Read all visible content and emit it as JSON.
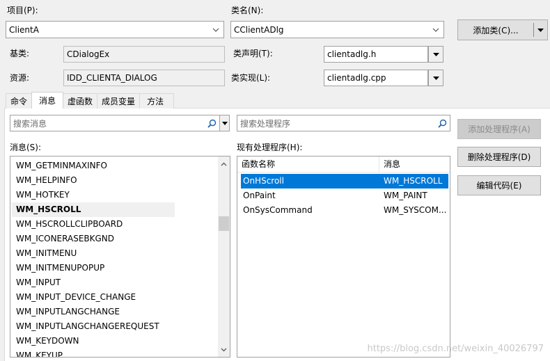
{
  "labels": {
    "project": "项目(P):",
    "classname": "类名(N):",
    "base_class": "基类:",
    "class_decl": "类声明(T):",
    "resource": "资源:",
    "class_impl": "类实现(L):"
  },
  "project_value": "ClientA",
  "classname_value": "CClientADlg",
  "add_class_button": "添加类(C)...",
  "base_class_value": "CDialogEx",
  "class_decl_value": "clientadlg.h",
  "resource_value": "IDD_CLIENTA_DIALOG",
  "class_impl_value": "clientadlg.cpp",
  "tabs": [
    "命令",
    "消息",
    "虚函数",
    "成员变量",
    "方法"
  ],
  "active_tab": "消息",
  "search_messages_placeholder": "搜索消息",
  "search_handlers_placeholder": "搜索处理程序",
  "messages_label": "消息(S):",
  "handlers_label": "现有处理程序(H):",
  "messages": [
    "WM_GETMINMAXINFO",
    "WM_HELPINFO",
    "WM_HOTKEY",
    "WM_HSCROLL",
    "WM_HSCROLLCLIPBOARD",
    "WM_ICONERASEBKGND",
    "WM_INITMENU",
    "WM_INITMENUPOPUP",
    "WM_INPUT",
    "WM_INPUT_DEVICE_CHANGE",
    "WM_INPUTLANGCHANGE",
    "WM_INPUTLANGCHANGEREQUEST",
    "WM_KEYDOWN",
    "WM_KEYUP"
  ],
  "selected_message": "WM_HSCROLL",
  "handler_columns": [
    "函数名称",
    "消息"
  ],
  "handlers": [
    {
      "function": "OnHScroll",
      "message": "WM_HSCROLL"
    },
    {
      "function": "OnPaint",
      "message": "WM_PAINT"
    },
    {
      "function": "OnSysCommand",
      "message": "WM_SYSCOM..."
    }
  ],
  "selected_handler": "OnHScroll",
  "buttons": {
    "add_handler": "添加处理程序(A)",
    "delete_handler": "删除处理程序(D)",
    "edit_code": "编辑代码(E)"
  },
  "watermark": "https://blog.csdn.net/weixin_40026797",
  "colors": {
    "selection": "#0078d7",
    "window_bg": "#f0f0f0"
  }
}
